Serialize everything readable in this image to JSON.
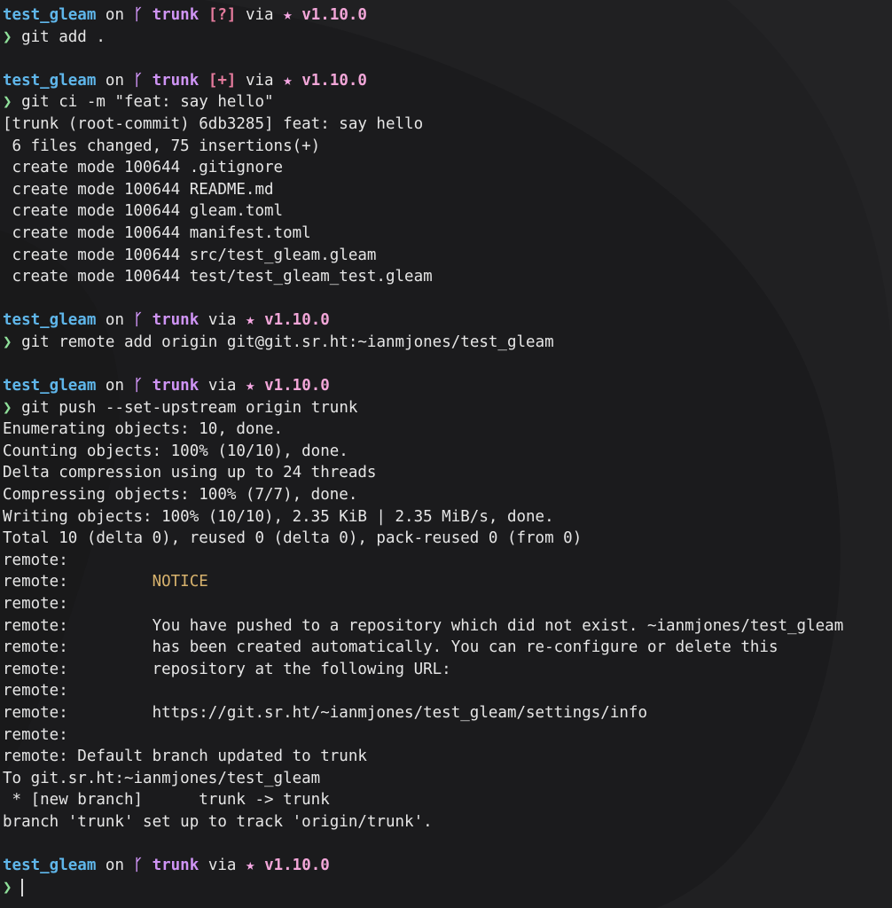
{
  "colors": {
    "background": "#1b1b1d",
    "directory": "#5fb6ea",
    "branch": "#cf94f5",
    "git_status": "#e57b9d",
    "version": "#f2a6d8",
    "prompt_char": "#8fe09a",
    "notice": "#d7b26d"
  },
  "icons": {
    "branch": "git-branch-icon",
    "star": "star-icon",
    "prompt": "chevron-right-icon"
  },
  "prompt": {
    "dir": "test_gleam",
    "on": "on",
    "branch_glyph": "ᚴ",
    "branch": "trunk",
    "via": "via",
    "star_glyph": "★",
    "version": "v1.10.0",
    "prompt_char": "❯"
  },
  "blocks": [
    {
      "status": "[?]",
      "command": "git add .",
      "output": []
    },
    {
      "status": "[+]",
      "command": "git ci -m \"feat: say hello\"",
      "output": [
        "[trunk (root-commit) 6db3285] feat: say hello",
        " 6 files changed, 75 insertions(+)",
        " create mode 100644 .gitignore",
        " create mode 100644 README.md",
        " create mode 100644 gleam.toml",
        " create mode 100644 manifest.toml",
        " create mode 100644 src/test_gleam.gleam",
        " create mode 100644 test/test_gleam_test.gleam"
      ]
    },
    {
      "status": "",
      "command": "git remote add origin git@git.sr.ht:~ianmjones/test_gleam",
      "output": []
    },
    {
      "status": "",
      "command": "git push --set-upstream origin trunk",
      "output": [
        "Enumerating objects: 10, done.",
        "Counting objects: 100% (10/10), done.",
        "Delta compression using up to 24 threads",
        "Compressing objects: 100% (7/7), done.",
        "Writing objects: 100% (10/10), 2.35 KiB | 2.35 MiB/s, done.",
        "Total 10 (delta 0), reused 0 (delta 0), pack-reused 0 (from 0)",
        "remote:",
        "remote:         NOTICE",
        "remote:",
        "remote:         You have pushed to a repository which did not exist. ~ianmjones/test_gleam",
        "remote:         has been created automatically. You can re-configure or delete this",
        "remote:         repository at the following URL:",
        "remote:",
        "remote:         https://git.sr.ht/~ianmjones/test_gleam/settings/info",
        "remote:",
        "remote: Default branch updated to trunk",
        "To git.sr.ht:~ianmjones/test_gleam",
        " * [new branch]      trunk -> trunk",
        "branch 'trunk' set up to track 'origin/trunk'."
      ]
    }
  ],
  "final_prompt": {
    "status": "",
    "command": ""
  }
}
